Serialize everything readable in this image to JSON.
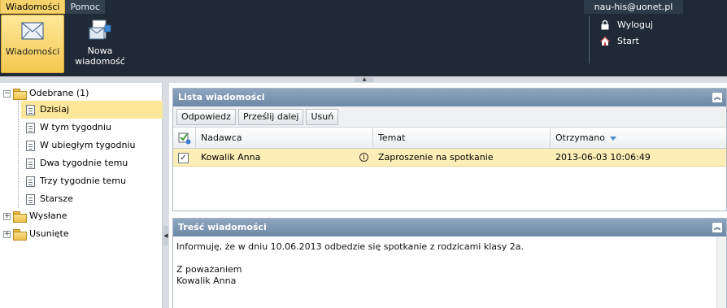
{
  "colors": {
    "topbar": "#1f2a36",
    "accent": "#f6d26a",
    "selection": "#fde79a",
    "pane_header": "#7b94b0"
  },
  "menu": {
    "tabs": [
      {
        "label": "Wiadomości"
      },
      {
        "label": "Pomoc"
      }
    ]
  },
  "user": {
    "email": "nau-his@uonet.pl"
  },
  "top_actions": {
    "logout_label": "Wyloguj",
    "start_label": "Start"
  },
  "ribbon": {
    "messages_label": "Wiadomości",
    "new_message_label": "Nowa\nwiadomość"
  },
  "tree": {
    "received": "Odebrane (1)",
    "children": [
      "Dzisiaj",
      "W tym tygodniu",
      "W ubiegłym tygodniu",
      "Dwa tygodnie temu",
      "Trzy tygodnie temu",
      "Starsze"
    ],
    "sent": "Wysłane",
    "deleted": "Usunięte"
  },
  "list_pane": {
    "title": "Lista wiadomości",
    "toolbar": {
      "reply": "Odpowiedz",
      "forward": "Prześlij dalej",
      "delete": "Usuń"
    },
    "columns": {
      "sender": "Nadawca",
      "subject": "Temat",
      "received": "Otrzymano"
    },
    "rows": [
      {
        "checked": true,
        "sender": "Kowalik Anna",
        "subject": "Zaproszenie na spotkanie",
        "received": "2013-06-03 10:06:49"
      }
    ]
  },
  "content_pane": {
    "title": "Treść wiadomości",
    "lines": [
      "Informuję, że w dniu 10.06.2013 odbedzie się spotkanie z rodzicami klasy 2a.",
      "",
      "Z poważaniem",
      "Kowalik Anna"
    ]
  }
}
